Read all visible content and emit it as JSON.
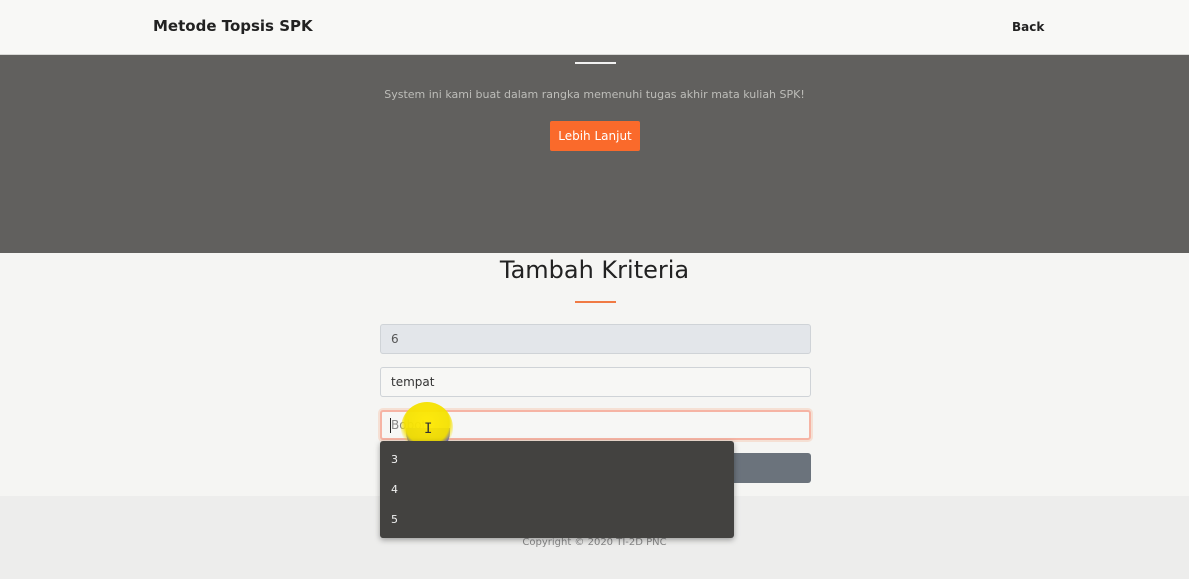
{
  "navbar": {
    "brand": "Metode Topsis SPK",
    "back": "Back"
  },
  "hero": {
    "text": "System ini kami buat dalam rangka memenuhi tugas akhir mata kuliah SPK!",
    "button": "Lebih Lanjut"
  },
  "form": {
    "title": "Tambah Kriteria",
    "id_value": "6",
    "name_value": "tempat",
    "weight_placeholder": "Bobot"
  },
  "autocomplete": {
    "options": [
      "3",
      "4",
      "5"
    ]
  },
  "footer": {
    "copyright": "Copyright © 2020 TI-2D PNC"
  },
  "colors": {
    "accent": "#fa6a2b",
    "hero_bg": "#61605e",
    "dropdown_bg": "#434240"
  },
  "icons": {
    "text_cursor": "text-cursor-icon"
  }
}
